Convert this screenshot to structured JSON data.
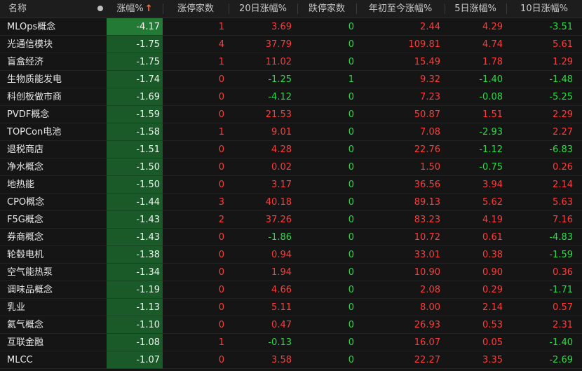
{
  "headers": {
    "name": "名称",
    "change": "涨幅%",
    "limit_up": "涨停家数",
    "chg20": "20日涨幅%",
    "limit_down": "跌停家数",
    "ytd": "年初至今涨幅%",
    "chg5": "5日涨幅%",
    "chg10": "10日涨幅%"
  },
  "icons": {
    "column_dot": "dot-icon",
    "sort_arrow": "sort-up-arrow-icon"
  },
  "colors": {
    "up": "#ff3b3b",
    "down": "#2fd94a",
    "highlight": "#1a5a28"
  },
  "rows": [
    {
      "name": "MLOps概念",
      "change": "-4.17",
      "limit_up": "1",
      "chg20": "3.69",
      "limit_down": "0",
      "ytd": "2.44",
      "chg5": "4.29",
      "chg10": "-3.51"
    },
    {
      "name": "光通信模块",
      "change": "-1.75",
      "limit_up": "4",
      "chg20": "37.79",
      "limit_down": "0",
      "ytd": "109.81",
      "chg5": "4.74",
      "chg10": "5.61"
    },
    {
      "name": "盲盒经济",
      "change": "-1.75",
      "limit_up": "1",
      "chg20": "11.02",
      "limit_down": "0",
      "ytd": "15.49",
      "chg5": "1.78",
      "chg10": "1.29"
    },
    {
      "name": "生物质能发电",
      "change": "-1.74",
      "limit_up": "0",
      "chg20": "-1.25",
      "limit_down": "1",
      "ytd": "9.32",
      "chg5": "-1.40",
      "chg10": "-1.48"
    },
    {
      "name": "科创板做市商",
      "change": "-1.69",
      "limit_up": "0",
      "chg20": "-4.12",
      "limit_down": "0",
      "ytd": "7.23",
      "chg5": "-0.08",
      "chg10": "-5.25"
    },
    {
      "name": "PVDF概念",
      "change": "-1.59",
      "limit_up": "0",
      "chg20": "21.53",
      "limit_down": "0",
      "ytd": "50.87",
      "chg5": "1.51",
      "chg10": "2.29"
    },
    {
      "name": "TOPCon电池",
      "change": "-1.58",
      "limit_up": "1",
      "chg20": "9.01",
      "limit_down": "0",
      "ytd": "7.08",
      "chg5": "-2.93",
      "chg10": "2.27"
    },
    {
      "name": "退税商店",
      "change": "-1.51",
      "limit_up": "0",
      "chg20": "4.28",
      "limit_down": "0",
      "ytd": "22.76",
      "chg5": "-1.12",
      "chg10": "-6.83"
    },
    {
      "name": "净水概念",
      "change": "-1.50",
      "limit_up": "0",
      "chg20": "0.02",
      "limit_down": "0",
      "ytd": "1.50",
      "chg5": "-0.75",
      "chg10": "0.26"
    },
    {
      "name": "地热能",
      "change": "-1.50",
      "limit_up": "0",
      "chg20": "3.17",
      "limit_down": "0",
      "ytd": "36.56",
      "chg5": "3.94",
      "chg10": "2.14"
    },
    {
      "name": "CPO概念",
      "change": "-1.44",
      "limit_up": "3",
      "chg20": "40.18",
      "limit_down": "0",
      "ytd": "89.13",
      "chg5": "5.62",
      "chg10": "5.63"
    },
    {
      "name": "F5G概念",
      "change": "-1.43",
      "limit_up": "2",
      "chg20": "37.26",
      "limit_down": "0",
      "ytd": "83.23",
      "chg5": "4.19",
      "chg10": "7.16"
    },
    {
      "name": "券商概念",
      "change": "-1.43",
      "limit_up": "0",
      "chg20": "-1.86",
      "limit_down": "0",
      "ytd": "10.72",
      "chg5": "0.61",
      "chg10": "-4.83"
    },
    {
      "name": "轮毂电机",
      "change": "-1.38",
      "limit_up": "0",
      "chg20": "0.94",
      "limit_down": "0",
      "ytd": "33.01",
      "chg5": "0.38",
      "chg10": "-1.59"
    },
    {
      "name": "空气能热泵",
      "change": "-1.34",
      "limit_up": "0",
      "chg20": "1.94",
      "limit_down": "0",
      "ytd": "10.90",
      "chg5": "0.90",
      "chg10": "0.36"
    },
    {
      "name": "调味品概念",
      "change": "-1.19",
      "limit_up": "0",
      "chg20": "4.66",
      "limit_down": "0",
      "ytd": "2.08",
      "chg5": "0.29",
      "chg10": "-1.71"
    },
    {
      "name": "乳业",
      "change": "-1.13",
      "limit_up": "0",
      "chg20": "5.11",
      "limit_down": "0",
      "ytd": "8.00",
      "chg5": "2.14",
      "chg10": "0.57"
    },
    {
      "name": "氦气概念",
      "change": "-1.10",
      "limit_up": "0",
      "chg20": "0.47",
      "limit_down": "0",
      "ytd": "26.93",
      "chg5": "0.53",
      "chg10": "2.31"
    },
    {
      "name": "互联金融",
      "change": "-1.08",
      "limit_up": "1",
      "chg20": "-0.13",
      "limit_down": "0",
      "ytd": "16.07",
      "chg5": "0.05",
      "chg10": "-1.40"
    },
    {
      "name": "MLCC",
      "change": "-1.07",
      "limit_up": "0",
      "chg20": "3.58",
      "limit_down": "0",
      "ytd": "22.27",
      "chg5": "3.35",
      "chg10": "-2.69"
    }
  ]
}
